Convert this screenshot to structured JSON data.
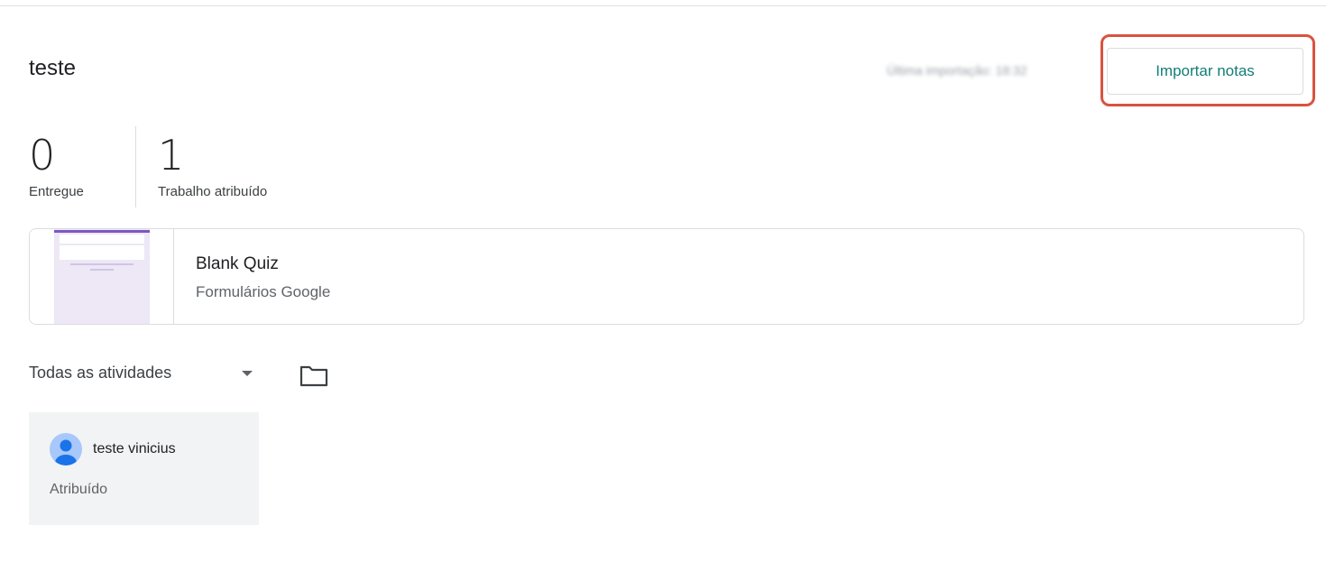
{
  "assignment": {
    "title": "teste",
    "last_import": "Última importação: 18:32",
    "import_button_label": "Importar notas"
  },
  "stats": [
    {
      "value": "0",
      "label": "Entregue"
    },
    {
      "value": "1",
      "label": "Trabalho atribuído"
    }
  ],
  "attachment": {
    "title": "Blank Quiz",
    "type": "Formulários Google"
  },
  "filter": {
    "selected": "Todas as atividades"
  },
  "students": [
    {
      "name": "teste vinicius",
      "status": "Atribuído"
    }
  ],
  "colors": {
    "accent": "#137e75",
    "highlight": "#d9533f",
    "forms_purple": "#7e57c2",
    "card_bg": "#f1f3f4"
  },
  "icons": {
    "folder": "folder-icon",
    "dropdown": "arrow-drop-down-icon",
    "avatar": "account-circle-icon"
  }
}
